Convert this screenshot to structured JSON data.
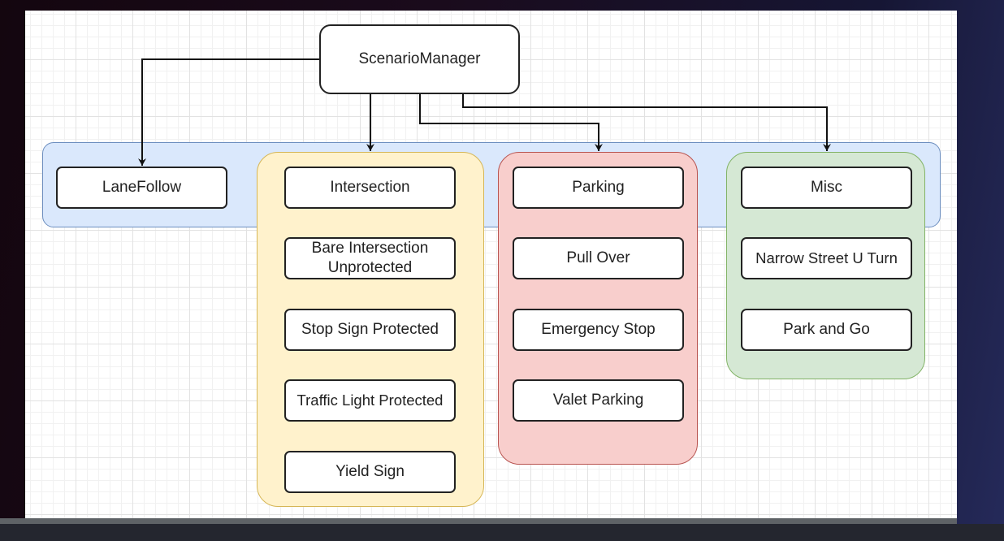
{
  "root": {
    "label": "ScenarioManager"
  },
  "colors": {
    "band": "#dae8fc",
    "band_stroke": "#6c8ebf",
    "intersection": "#fff2cc",
    "intersection_stroke": "#d6b656",
    "parking": "#f8cecc",
    "parking_stroke": "#b85450",
    "misc": "#d5e8d4",
    "misc_stroke": "#82b366"
  },
  "lanefollow": {
    "label": "LaneFollow"
  },
  "groups": {
    "intersection": [
      "Intersection",
      "Bare Intersection Unprotected",
      "Stop Sign Protected",
      "Traffic Light Protected",
      "Yield Sign"
    ],
    "parking": [
      "Parking",
      "Pull Over",
      "Emergency Stop",
      "Valet Parking"
    ],
    "misc": [
      "Misc",
      "Narrow Street U Turn",
      "Park and Go"
    ]
  }
}
